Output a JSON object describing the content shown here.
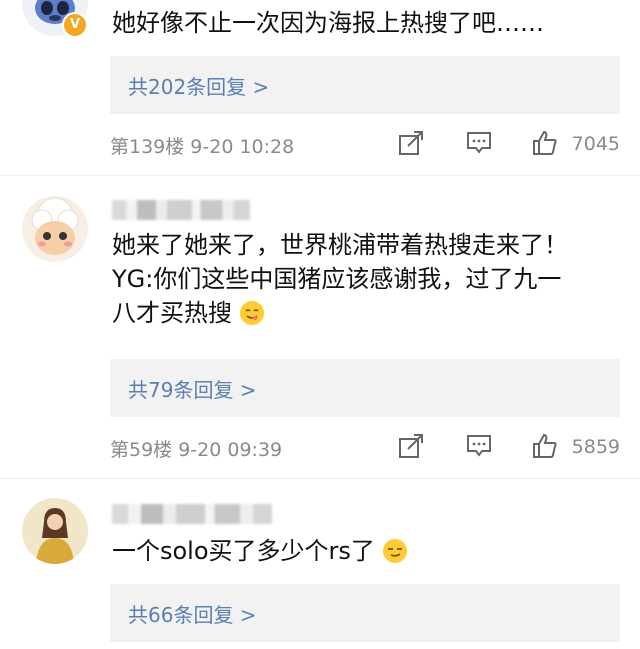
{
  "comments": [
    {
      "text": "她好像不止一次因为海报上热搜了吧……",
      "replies": "共202条回复 >",
      "floor": "第139楼  9-20 10:28",
      "likes": "7045"
    },
    {
      "text_line1": "她来了她来了，世界桃浦带着热搜走来了！",
      "text_line2": "YG:你们这些中国猪应该感谢我，过了九一",
      "text_line3": "八才买热搜",
      "replies": "共79条回复 >",
      "floor": "第59楼  9-20 09:39",
      "likes": "5859"
    },
    {
      "text": "一个solo买了多少个rs了",
      "replies": "共66条回复 >"
    }
  ],
  "icons": [
    "verified-badge-icon",
    "share-icon",
    "comment-icon",
    "like-icon",
    "yummy-emoji-icon",
    "smirk-emoji-icon"
  ],
  "colors": {
    "reply_link": "#5a7fb0",
    "reply_bg": "#f2f2f2",
    "meta": "#8a8a8a",
    "badge": "#f5a623"
  }
}
